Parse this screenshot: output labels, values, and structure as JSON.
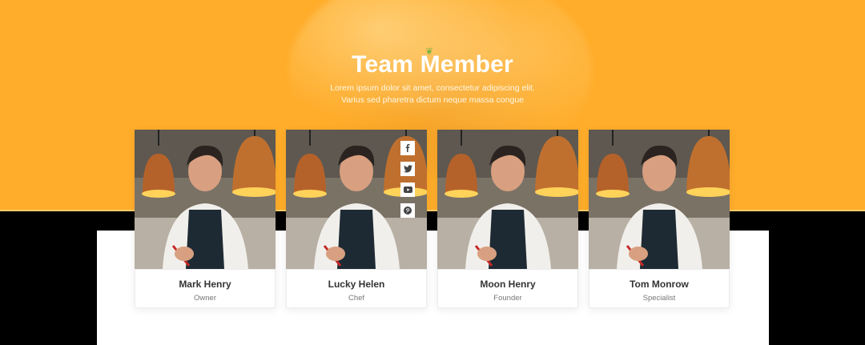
{
  "header": {
    "title": "Team Member",
    "subtitle_line1": "Lorem ipsum dolor sit amet, consectetur adipiscing elit.",
    "subtitle_line2": "Varius sed pharetra dictum neque massa congue"
  },
  "colors": {
    "hero_bg": "#ffad2a",
    "name_text": "#333333",
    "role_text": "#777777"
  },
  "team": [
    {
      "name": "Mark Henry",
      "role": "Owner"
    },
    {
      "name": "Lucky Helen",
      "role": "Chef"
    },
    {
      "name": "Moon Henry",
      "role": "Founder"
    },
    {
      "name": "Tom Monrow",
      "role": "Specialist"
    }
  ],
  "social_icons": [
    "facebook-icon",
    "twitter-icon",
    "youtube-icon",
    "pinterest-icon"
  ]
}
